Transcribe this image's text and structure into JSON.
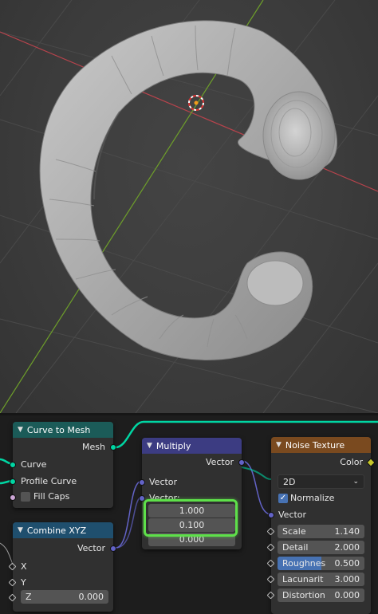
{
  "nodes": {
    "curve_to_mesh": {
      "title": "Curve to Mesh",
      "output_mesh": "Mesh",
      "input_curve": "Curve",
      "input_profile": "Profile Curve",
      "fill_caps": "Fill Caps"
    },
    "combine_xyz": {
      "title": "Combine XYZ",
      "output_vector": "Vector",
      "input_x": "X",
      "input_y": "Y",
      "z_label": "Z",
      "z_value": "0.000"
    },
    "multiply": {
      "title": "Multiply",
      "output_vector": "Vector",
      "input_vector_1": "Vector",
      "input_vector_2": "Vector:",
      "values": [
        "1.000",
        "0.100",
        "0.000"
      ]
    },
    "noise_texture": {
      "title": "Noise Texture",
      "output_color": "Color",
      "dimension": "2D",
      "normalize": "Normalize",
      "input_vector": "Vector",
      "fields": [
        {
          "label": "Scale",
          "value": "1.140"
        },
        {
          "label": "Detail",
          "value": "2.000"
        },
        {
          "label": "Roughnes",
          "value": "0.500"
        },
        {
          "label": "Lacunarit",
          "value": "3.000"
        },
        {
          "label": "Distortion",
          "value": "0.000"
        }
      ],
      "roughness_fill": 0.5
    }
  },
  "colors": {
    "geometry_socket": "#00d6a3",
    "vector_socket": "#6363c7",
    "highlight": "#5ee04a",
    "x_axis": "#b8434c",
    "y_axis": "#6e9f2a"
  }
}
